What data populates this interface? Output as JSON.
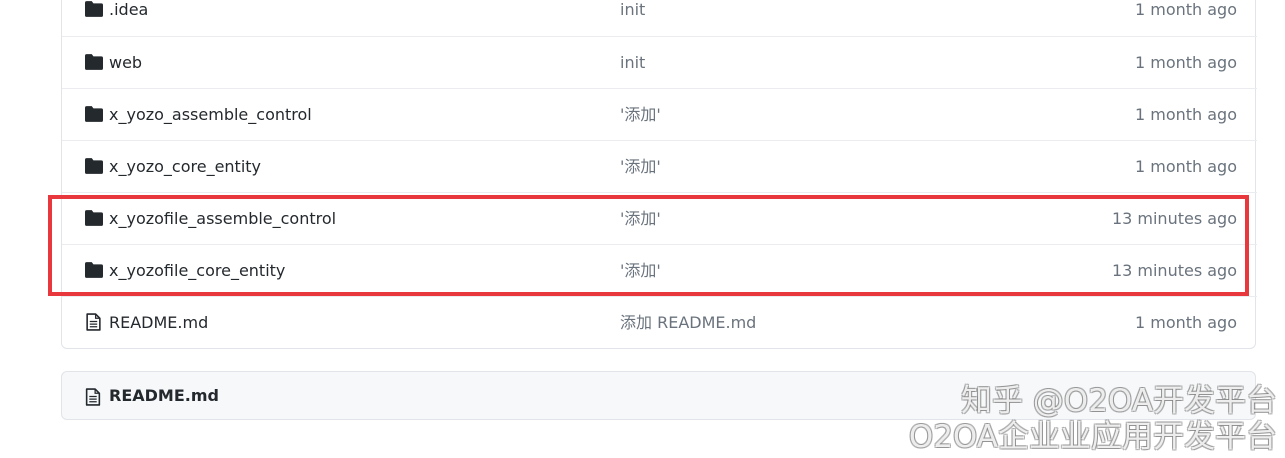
{
  "files": [
    {
      "name": ".idea",
      "type": "folder",
      "message": "init",
      "age": "1 month ago"
    },
    {
      "name": "web",
      "type": "folder",
      "message": "init",
      "age": "1 month ago"
    },
    {
      "name": "x_yozo_assemble_control",
      "type": "folder",
      "message": "'添加'",
      "age": "1 month ago"
    },
    {
      "name": "x_yozo_core_entity",
      "type": "folder",
      "message": "'添加'",
      "age": "1 month ago"
    },
    {
      "name": "x_yozofile_assemble_control",
      "type": "folder",
      "message": "'添加'",
      "age": "13 minutes ago"
    },
    {
      "name": "x_yozofile_core_entity",
      "type": "folder",
      "message": "'添加'",
      "age": "13 minutes ago"
    },
    {
      "name": "README.md",
      "type": "file",
      "message": "添加 README.md",
      "age": "1 month ago"
    }
  ],
  "readme": {
    "title": "README.md"
  },
  "watermark": {
    "line1": "知乎 @O2OA开发平台",
    "line2": "O2OA企业业应用开发平台"
  },
  "colors": {
    "highlight": "#e8383d",
    "border": "#e1e4e8",
    "muted_text": "#6a737d",
    "text": "#24292e"
  }
}
